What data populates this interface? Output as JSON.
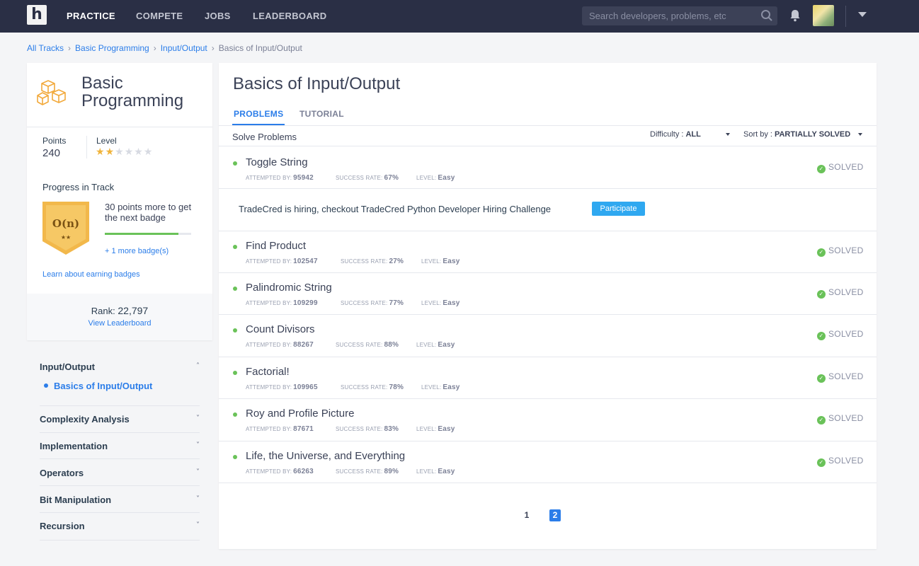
{
  "nav": {
    "links": [
      "PRACTICE",
      "COMPETE",
      "JOBS",
      "LEADERBOARD"
    ],
    "search_placeholder": "Search developers, problems, etc"
  },
  "breadcrumb": [
    "All Tracks",
    "Basic Programming",
    "Input/Output",
    "Basics of Input/Output"
  ],
  "track": {
    "title": "Basic Programming",
    "points_label": "Points",
    "points": "240",
    "level_label": "Level",
    "level_stars": 2,
    "level_max": 6,
    "progress_title": "Progress in Track",
    "badge_text": "O(n)",
    "badge_stars": "★★",
    "next_badge": "30 points more to get the next badge",
    "next_badge_progress": 0.85,
    "more_badges": "+ 1 more badge(s)",
    "learn_badges": "Learn about earning badges",
    "rank_label": "Rank:",
    "rank_value": "22,797",
    "view_leaderboard": "View Leaderboard"
  },
  "menu": {
    "active_section": "Input/Output",
    "active_item": "Basics of Input/Output",
    "sections": [
      "Complexity Analysis",
      "Implementation",
      "Operators",
      "Bit Manipulation",
      "Recursion"
    ]
  },
  "main": {
    "title": "Basics of Input/Output",
    "tabs": [
      "PROBLEMS",
      "TUTORIAL"
    ],
    "solve_label": "Solve Problems",
    "difficulty_label": "Difficulty :",
    "difficulty_value": "ALL",
    "sortby_label": "Sort by :",
    "sortby_value": "PARTIALLY SOLVED",
    "attempted_label": "ATTEMPTED BY:",
    "success_label": "SUCCESS RATE:",
    "level_label": "LEVEL:",
    "status_label": "SOLVED",
    "problems": [
      {
        "title": "Toggle String",
        "attempted": "95942",
        "success": "67%",
        "level": "Easy"
      },
      {
        "title": "Find Product",
        "attempted": "102547",
        "success": "27%",
        "level": "Easy"
      },
      {
        "title": "Palindromic String",
        "attempted": "109299",
        "success": "77%",
        "level": "Easy"
      },
      {
        "title": "Count Divisors",
        "attempted": "88267",
        "success": "88%",
        "level": "Easy"
      },
      {
        "title": "Factorial!",
        "attempted": "109965",
        "success": "78%",
        "level": "Easy"
      },
      {
        "title": "Roy and Profile Picture",
        "attempted": "87671",
        "success": "83%",
        "level": "Easy"
      },
      {
        "title": "Life, the Universe, and Everything",
        "attempted": "66263",
        "success": "89%",
        "level": "Easy"
      }
    ],
    "promo_text": "TradeCred is hiring, checkout TradeCred Python Developer Hiring Challenge",
    "promo_button": "Participate",
    "pages": [
      "1",
      "2"
    ],
    "current_page": "2"
  },
  "colors": {
    "nav_bg": "#2a2f45",
    "accent": "#2b7de9",
    "success": "#6ac259",
    "participate": "#2fa8f0",
    "badge_gold": "#f2b84b"
  }
}
